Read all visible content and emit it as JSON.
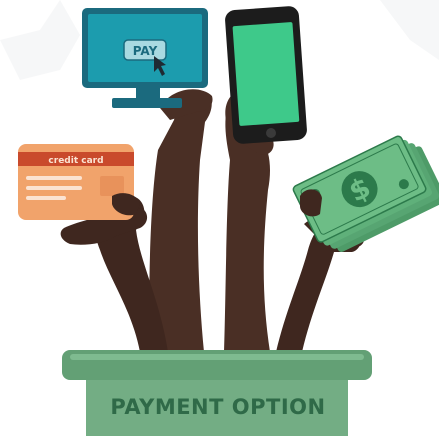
{
  "illustration": {
    "box_label": "PAYMENT OPTION",
    "monitor_button_label": "PAY",
    "card_label": "credit card",
    "currency_symbol": "$"
  },
  "colors": {
    "skin": "#4a2f25",
    "skin_dark": "#3d251d",
    "box_green": "#73ad84",
    "box_rim": "#63a075",
    "box_text": "#2f6a48",
    "monitor_teal": "#1c9cae",
    "monitor_frame": "#1b6a7e",
    "phone_screen": "#3ec98a",
    "phone_body": "#1c1c1c",
    "card_orange": "#f1a36b",
    "card_stripe": "#c94a2c",
    "cash_green": "#5fb07a",
    "cash_dark": "#2c7a4b"
  }
}
